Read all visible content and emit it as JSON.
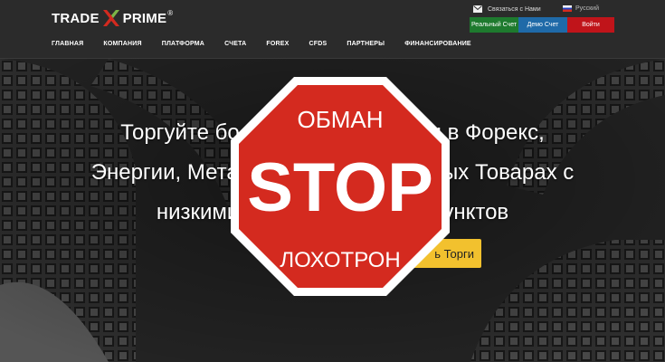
{
  "brand": {
    "left": "TRADE",
    "right": "PRIME",
    "reg": "®"
  },
  "nav": {
    "items": [
      "ГЛАВНАЯ",
      "КОМПАНИЯ",
      "ПЛАТФОРМА",
      "СЧЕТА",
      "FOREX",
      "CFDS",
      "ПАРТНЕРЫ",
      "ФИНАНСИРОВАНИЕ"
    ]
  },
  "topbar": {
    "contact_label": "Связаться с Нами",
    "language": "Русский",
    "real_account": "Реальный Счет",
    "demo_account": "Демо Счет",
    "login": "Войти"
  },
  "hero": {
    "line1": "Торгуйте бо                           ами в Форекс,",
    "line2": "Энергии, Мета                          рьевых Товарах с",
    "line3": "низкими                          с 9 пунктов",
    "cta": "ь Торги"
  },
  "stop_sign": {
    "top": "ОБМАН",
    "middle": "STOP",
    "bottom": "ЛОХОТРОН",
    "color": "#d42a1f"
  },
  "colors": {
    "header_bg": "#2b2b2b",
    "accent_red": "#c0141a",
    "accent_green": "#1e7a2e",
    "accent_blue": "#1f6aa8",
    "cta_yellow": "#f2c12e"
  }
}
